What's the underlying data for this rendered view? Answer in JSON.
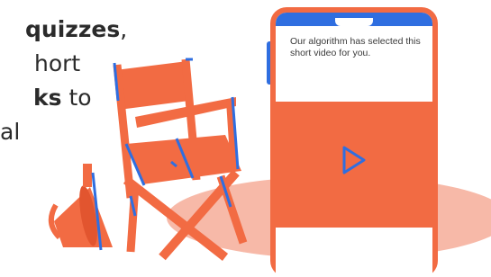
{
  "marketing": {
    "line1_bold": "quizzes",
    "line1_tail": ",",
    "line2": "hort",
    "line3_bold": "ks",
    "line3_tail": " to",
    "line4": "al"
  },
  "phone": {
    "message": "Our algorithm has selected this short video for you."
  },
  "colors": {
    "accent": "#f26b43",
    "blue": "#2f6ee0",
    "floor": "#f7b9a8"
  },
  "icons": [
    "megaphone-icon",
    "director-chair-icon",
    "phone-icon",
    "play-icon"
  ]
}
